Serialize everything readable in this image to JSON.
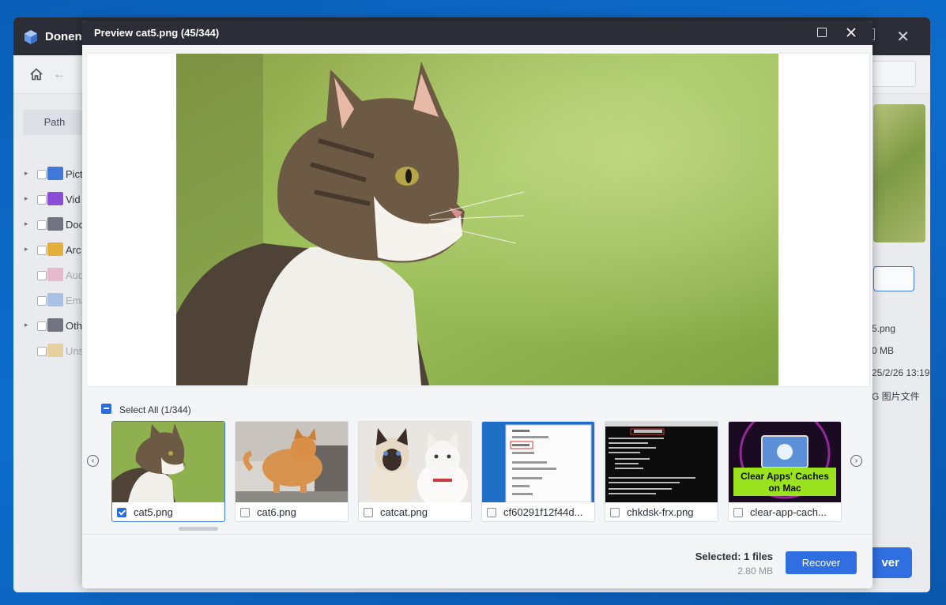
{
  "app": {
    "title": "Donen",
    "path_tab": "Path",
    "tree": [
      {
        "label": "Pict",
        "caret": "▸",
        "color": "#3f78d6",
        "dim": false
      },
      {
        "label": "Vid",
        "caret": "▸",
        "color": "#8a4fd6",
        "dim": false
      },
      {
        "label": "Doc",
        "caret": "▸",
        "color": "#6f7480",
        "dim": false
      },
      {
        "label": "Arc",
        "caret": "▸",
        "color": "#e2b03a",
        "dim": false
      },
      {
        "label": "Aud",
        "caret": "",
        "color": "#e07fa0",
        "dim": true
      },
      {
        "label": "Ema",
        "caret": "",
        "color": "#5a8cd8",
        "dim": true
      },
      {
        "label": "Oth",
        "caret": "▸",
        "color": "#6f7480",
        "dim": false
      },
      {
        "label": "Uns",
        "caret": "",
        "color": "#e2b03a",
        "dim": true
      }
    ],
    "info": [
      "5.png",
      "0 MB",
      "25/2/26 13:19",
      "G 图片文件"
    ],
    "recover_label": "ver"
  },
  "dialog": {
    "title": "Preview cat5.png (45/344)",
    "select_all": "Select All (1/344)",
    "thumbnails": [
      {
        "name": "cat5.png",
        "checked": true
      },
      {
        "name": "cat6.png",
        "checked": false
      },
      {
        "name": "catcat.png",
        "checked": false
      },
      {
        "name": "cf60291f12f44d...",
        "checked": false
      },
      {
        "name": "chkdsk-frx.png",
        "checked": false
      },
      {
        "name": "clear-app-cach...",
        "checked": false
      }
    ],
    "thumb_banner": [
      "Clear Apps' Caches",
      "on Mac"
    ],
    "selected_text": "Selected: 1 files",
    "size_text": "2.80 MB",
    "recover_label": "Recover",
    "prev_arrow": "‹",
    "next_arrow": "›"
  },
  "colors": {
    "accent": "#2f6fe2",
    "titlebar": "#2b2e37",
    "desktop": "#0d6ccc"
  }
}
